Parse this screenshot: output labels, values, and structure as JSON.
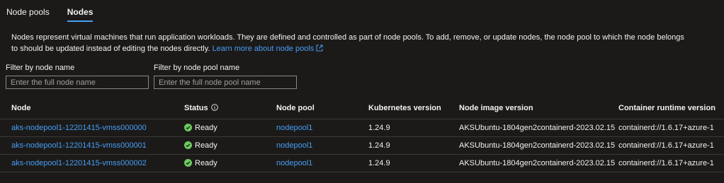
{
  "tabs": [
    {
      "label": "Node pools",
      "selected": false
    },
    {
      "label": "Nodes",
      "selected": true
    }
  ],
  "description": {
    "text": "Nodes represent virtual machines that run application workloads. They are defined and controlled as part of node pools. To add, remove, or update nodes, the node pool to which the node belongs to should be updated instead of editing the nodes directly.",
    "link_label": "Learn more about node pools"
  },
  "filters": {
    "node_name": {
      "label": "Filter by node name",
      "placeholder": "Enter the full node name",
      "value": ""
    },
    "node_pool_name": {
      "label": "Filter by node pool name",
      "placeholder": "Enter the full node pool name",
      "value": ""
    }
  },
  "table": {
    "columns": [
      "Node",
      "Status",
      "Node pool",
      "Kubernetes version",
      "Node image version",
      "Container runtime version"
    ],
    "rows": [
      {
        "node": "aks-nodepool1-12201415-vmss000000",
        "status": "Ready",
        "pool": "nodepool1",
        "k8s": "1.24.9",
        "image": "AKSUbuntu-1804gen2containerd-2023.02.15",
        "runtime": "containerd://1.6.17+azure-1"
      },
      {
        "node": "aks-nodepool1-12201415-vmss000001",
        "status": "Ready",
        "pool": "nodepool1",
        "k8s": "1.24.9",
        "image": "AKSUbuntu-1804gen2containerd-2023.02.15",
        "runtime": "containerd://1.6.17+azure-1"
      },
      {
        "node": "aks-nodepool1-12201415-vmss000002",
        "status": "Ready",
        "pool": "nodepool1",
        "k8s": "1.24.9",
        "image": "AKSUbuntu-1804gen2containerd-2023.02.15",
        "runtime": "containerd://1.6.17+azure-1"
      }
    ]
  },
  "icons": {
    "status_ready": "checkmark-circle-icon",
    "status_info": "info-icon",
    "external_link": "external-link-icon"
  },
  "colors": {
    "background": "#1b1a19",
    "link": "#479ef5",
    "success": "#6ccb5f",
    "tab_indicator": "#479ef5"
  }
}
